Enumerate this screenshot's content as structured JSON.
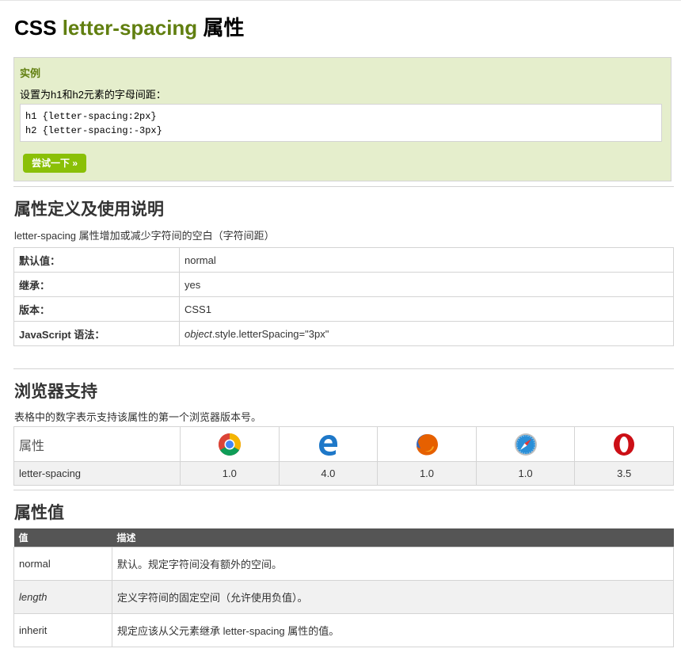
{
  "title": {
    "prefix": "CSS",
    "property": "letter-spacing",
    "suffix": "属性"
  },
  "example": {
    "heading": "实例",
    "description": "设置为h1和h2元素的字母间距：",
    "code_line1": "h1 {letter-spacing:2px}",
    "code_line2": "h2 {letter-spacing:-3px}",
    "try_button": "尝试一下 »"
  },
  "definition": {
    "heading": "属性定义及使用说明",
    "intro": "letter-spacing 属性增加或减少字符间的空白（字符间距）",
    "rows": [
      {
        "key": "默认值：",
        "value": "normal"
      },
      {
        "key": "继承：",
        "value": "yes"
      },
      {
        "key": "版本：",
        "value": "CSS1"
      },
      {
        "key": "JavaScript 语法：",
        "value_italic": "object",
        "value": ".style.letterSpacing=\"3px\""
      }
    ]
  },
  "browsers": {
    "heading": "浏览器支持",
    "intro": "表格中的数字表示支持该属性的第一个浏览器版本号。",
    "header_label": "属性",
    "icons": [
      "chrome-icon",
      "edge-icon",
      "firefox-icon",
      "safari-icon",
      "opera-icon"
    ],
    "row_label": "letter-spacing",
    "versions": [
      "1.0",
      "4.0",
      "1.0",
      "1.0",
      "3.5"
    ]
  },
  "values": {
    "heading": "属性值",
    "col_value": "值",
    "col_desc": "描述",
    "rows": [
      {
        "value": "normal",
        "desc": "默认。规定字符间没有额外的空间。"
      },
      {
        "value": "length",
        "desc": "定义字符间的固定空间（允许使用负值）。"
      },
      {
        "value": "inherit",
        "desc": "规定应该从父元素继承 letter-spacing 属性的值。"
      }
    ]
  },
  "colors": {
    "accent": "#617f10",
    "button": "#8ac007",
    "example_bg": "#e5eecc",
    "table_header": "#555555"
  }
}
